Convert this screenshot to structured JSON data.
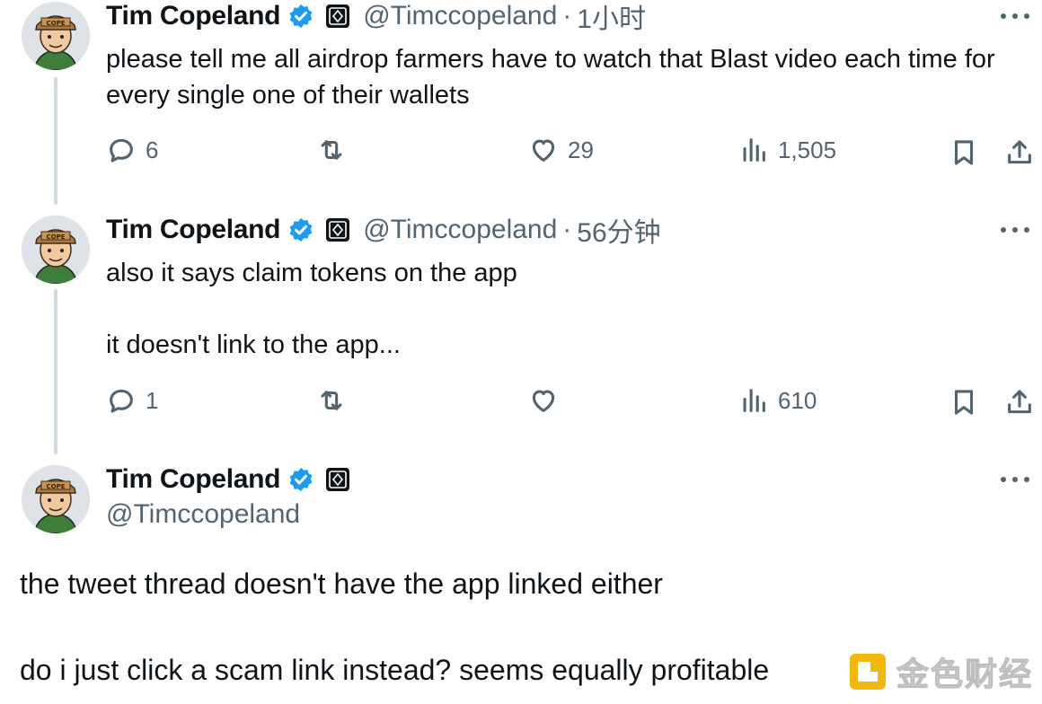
{
  "tweets": [
    {
      "name": "Tim Copeland",
      "handle": "@Timccopeland",
      "separator": "·",
      "time": "1小时",
      "text": "please tell me all airdrop farmers have to watch that Blast video each time for every single one of their wallets",
      "replies": "6",
      "retweets": "",
      "likes": "29",
      "views": "1,505"
    },
    {
      "name": "Tim Copeland",
      "handle": "@Timccopeland",
      "separator": "·",
      "time": "56分钟",
      "text": "also it says claim tokens on the app\n\nit doesn't link to the app...",
      "replies": "1",
      "retweets": "",
      "likes": "",
      "views": "610"
    },
    {
      "name": "Tim Copeland",
      "handle": "@Timccopeland",
      "text": "the tweet thread doesn't have the app linked either\n\ndo i just click a scam link instead? seems equally profitable"
    }
  ],
  "icons": {
    "verified_color": "#1d9bf0",
    "reply": "reply-icon",
    "retweet": "retweet-icon",
    "like": "heart-icon",
    "views": "views-icon",
    "bookmark": "bookmark-icon",
    "share": "share-icon",
    "more": "more-icon"
  },
  "watermark": {
    "text": "金色财经"
  }
}
